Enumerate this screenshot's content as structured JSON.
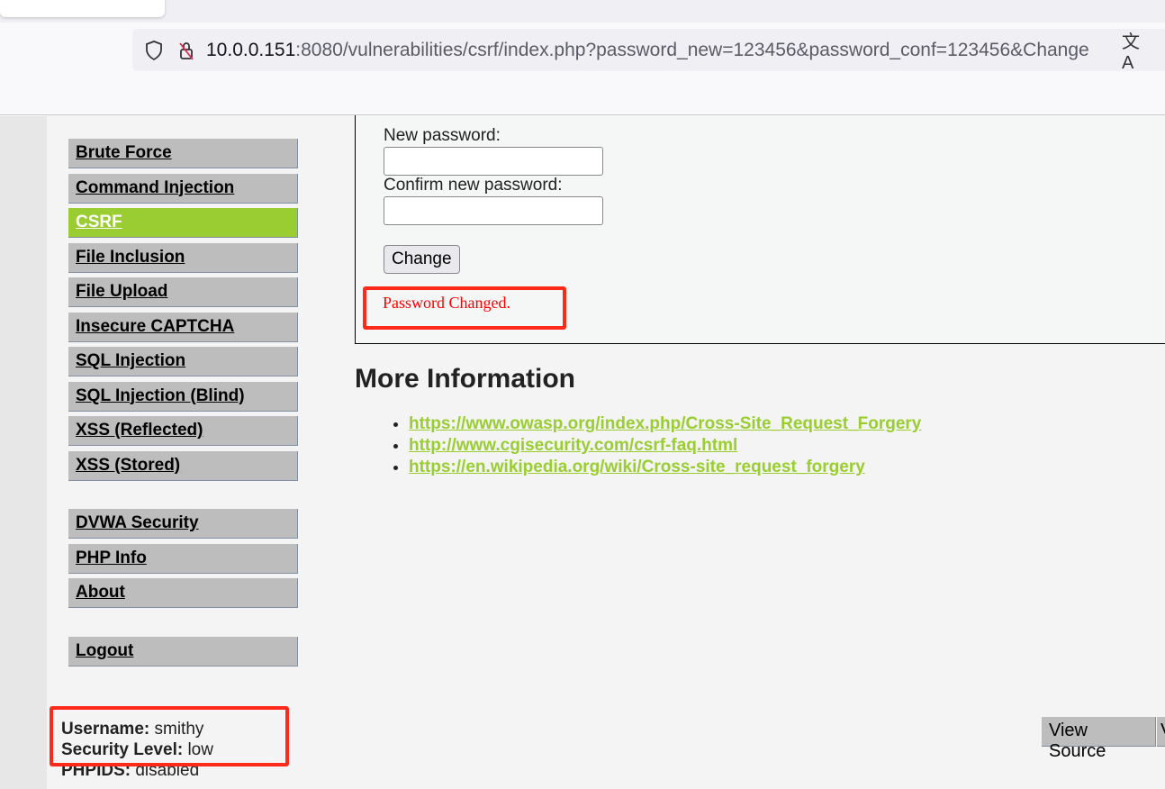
{
  "browser": {
    "url_host": "10.0.0.151",
    "url_rest": ":8080/vulnerabilities/csrf/index.php?password_new=123456&password_conf=123456&Change"
  },
  "sidebar": {
    "groups": [
      [
        {
          "label": "Brute Force"
        },
        {
          "label": "Command Injection"
        },
        {
          "label": "CSRF",
          "active": true
        },
        {
          "label": "File Inclusion"
        },
        {
          "label": "File Upload"
        },
        {
          "label": "Insecure CAPTCHA"
        },
        {
          "label": "SQL Injection"
        },
        {
          "label": "SQL Injection (Blind)"
        },
        {
          "label": "XSS (Reflected)"
        },
        {
          "label": "XSS (Stored)"
        }
      ],
      [
        {
          "label": "DVWA Security"
        },
        {
          "label": "PHP Info"
        },
        {
          "label": "About"
        }
      ],
      [
        {
          "label": "Logout"
        }
      ]
    ]
  },
  "form": {
    "new_label": "New password:",
    "confirm_label": "Confirm new password:",
    "new_value": "",
    "confirm_value": "",
    "button": "Change",
    "message": "Password Changed."
  },
  "more_info": {
    "title": "More Information",
    "links": [
      "https://www.owasp.org/index.php/Cross-Site_Request_Forgery",
      "http://www.cgisecurity.com/csrf-faq.html",
      "https://en.wikipedia.org/wiki/Cross-site_request_forgery"
    ]
  },
  "user": {
    "username_label": "Username:",
    "username": "smithy",
    "security_label": "Security Level:",
    "security": "low",
    "phpids_label": "PHPIDS:",
    "phpids": "disabled"
  },
  "footer": {
    "view_source": "View Source",
    "second_button_partial": "V"
  },
  "colors": {
    "accent": "#9acd32",
    "message": "#ff0000",
    "annotation": "#ff2a1a"
  }
}
